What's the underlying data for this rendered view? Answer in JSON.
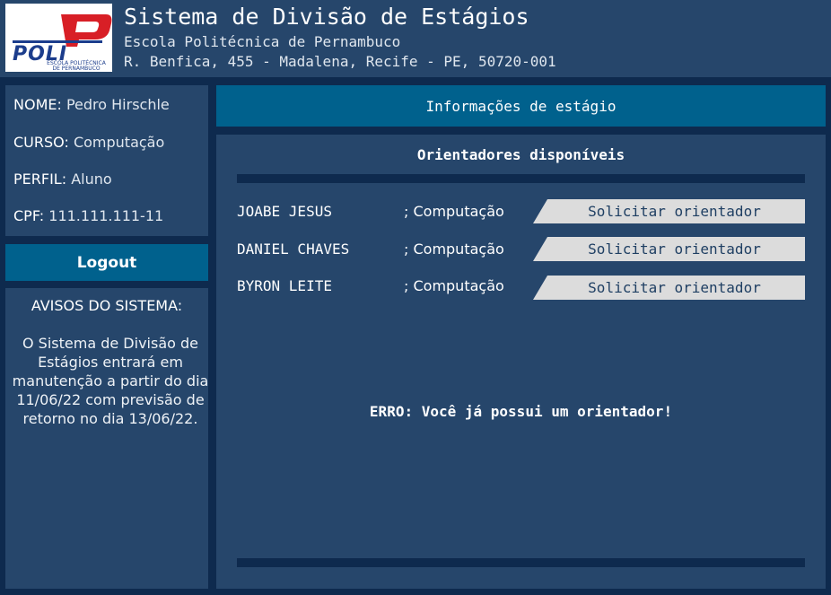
{
  "header": {
    "logo_text": "POLI",
    "logo_subtitle_1": "ESCOLA POLITÉCNICA",
    "logo_subtitle_2": "DE PERNAMBUCO",
    "title": "Sistema de Divisão de Estágios",
    "subtitle": "Escola Politécnica de Pernambuco",
    "address": "R. Benfica, 455 - Madalena, Recife - PE, 50720-001"
  },
  "user": {
    "name_label": "NOME:",
    "name_value": "Pedro Hirschle",
    "course_label": "CURSO:",
    "course_value": "Computação",
    "profile_label": "PERFIL:",
    "profile_value": "Aluno",
    "cpf_label": "CPF:",
    "cpf_value": "111.111.111-11"
  },
  "logout_label": "Logout",
  "notices": {
    "title": "AVISOS DO SISTEMA:",
    "body": "O Sistema de Divisão de Estágios entrará em manutenção a partir do dia 11/06/22 com previsão de retorno no dia 13/06/22."
  },
  "info_bar_label": "Informações de estágio",
  "main": {
    "title": "Orientadores disponíveis",
    "advisors": [
      {
        "name": "JOABE JESUS",
        "course": "; Computação",
        "button": "Solicitar orientador"
      },
      {
        "name": "DANIEL CHAVES",
        "course": "; Computação",
        "button": "Solicitar orientador"
      },
      {
        "name": "BYRON LEITE",
        "course": "; Computação",
        "button": "Solicitar orientador"
      }
    ],
    "error": "ERRO: Você já possui um orientador!"
  },
  "colors": {
    "background": "#0e2a4e",
    "panel": "#26466b",
    "accent": "#00618d",
    "button": "#dcdcdc"
  }
}
